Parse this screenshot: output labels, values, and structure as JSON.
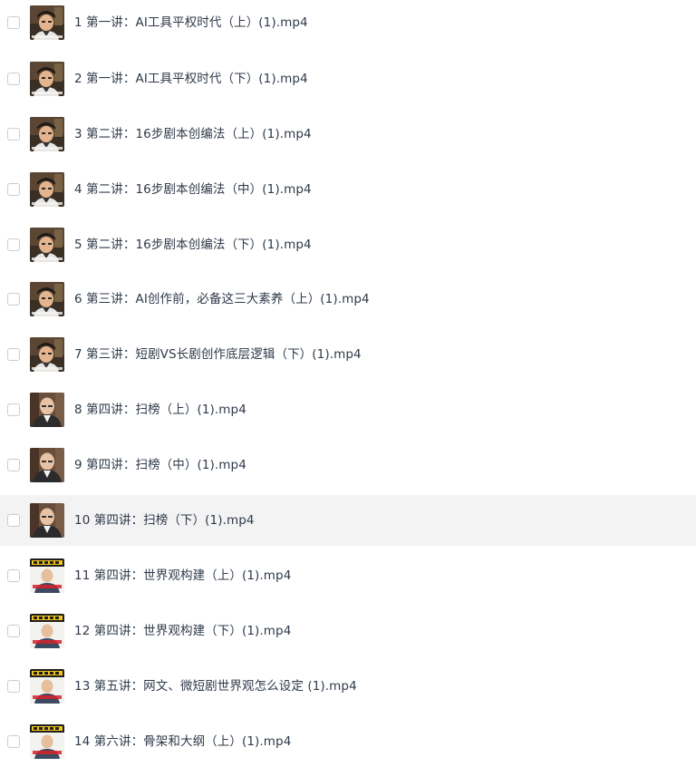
{
  "files": [
    {
      "name": "1 第一讲：AI工具平权时代（上）(1).mp4",
      "thumb": "thumb-hat-man-icon",
      "selected": false
    },
    {
      "name": "2 第一讲：AI工具平权时代（下）(1).mp4",
      "thumb": "thumb-hat-man-icon",
      "selected": false
    },
    {
      "name": "3 第二讲：16步剧本创编法（上）(1).mp4",
      "thumb": "thumb-hat-man-icon",
      "selected": false
    },
    {
      "name": "4 第二讲：16步剧本创编法（中）(1).mp4",
      "thumb": "thumb-hat-man-icon",
      "selected": false
    },
    {
      "name": "5 第二讲：16步剧本创编法（下）(1).mp4",
      "thumb": "thumb-hat-man-icon",
      "selected": false
    },
    {
      "name": "6 第三讲：AI创作前，必备这三大素养（上）(1).mp4",
      "thumb": "thumb-hat-man-icon",
      "selected": false
    },
    {
      "name": "7 第三讲：短剧VS长剧创作底层逻辑（下）(1).mp4",
      "thumb": "thumb-hat-man-icon",
      "selected": false
    },
    {
      "name": "8 第四讲：扫榜（上）(1).mp4",
      "thumb": "thumb-bald-man-icon",
      "selected": false
    },
    {
      "name": "9 第四讲：扫榜（中）(1).mp4",
      "thumb": "thumb-bald-man-icon",
      "selected": false
    },
    {
      "name": "10 第四讲：扫榜（下）(1).mp4",
      "thumb": "thumb-bald-man-icon",
      "selected": false
    },
    {
      "name": "11 第四讲：世界观构建（上）(1).mp4",
      "thumb": "thumb-title-card-icon",
      "selected": false
    },
    {
      "name": "12 第四讲：世界观构建（下）(1).mp4",
      "thumb": "thumb-title-card-icon",
      "selected": false
    },
    {
      "name": "13 第五讲：网文、微短剧世界观怎么设定 (1).mp4",
      "thumb": "thumb-title-card-icon",
      "selected": false
    },
    {
      "name": "14 第六讲：骨架和大纲（上）(1).mp4",
      "thumb": "thumb-title-card-icon",
      "selected": false
    }
  ],
  "hovered_index": 9,
  "colors": {
    "text": "#2f3a4a",
    "hover_bg": "#f3f3f3",
    "checkbox_border": "#c9cdd4"
  }
}
